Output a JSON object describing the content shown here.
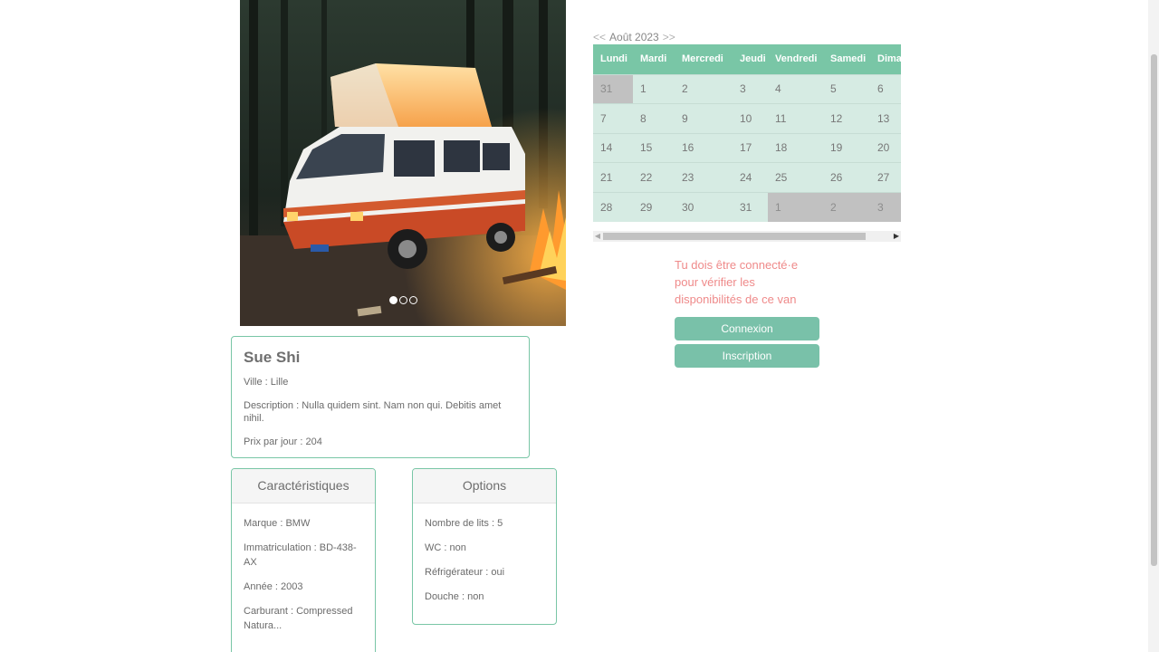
{
  "carousel": {
    "slides": 3,
    "active_slide": 1
  },
  "calendar": {
    "prev": "<<",
    "month_label": "Août 2023",
    "next": ">>",
    "weekdays": [
      "Lundi",
      "Mardi",
      "Mercredi",
      "Jeudi",
      "Vendredi",
      "Samedi",
      "Dimanche"
    ],
    "weeks": [
      [
        "31",
        "1",
        "2",
        "3",
        "4",
        "5",
        "6"
      ],
      [
        "7",
        "8",
        "9",
        "10",
        "11",
        "12",
        "13"
      ],
      [
        "14",
        "15",
        "16",
        "17",
        "18",
        "19",
        "20"
      ],
      [
        "21",
        "22",
        "23",
        "24",
        "25",
        "26",
        "27"
      ],
      [
        "28",
        "29",
        "30",
        "31",
        "1",
        "2",
        "3"
      ]
    ],
    "out_of_month": [
      "0.0",
      "4.4",
      "4.5",
      "4.6"
    ]
  },
  "auth": {
    "message": "Tu dois être connecté·e pour vérifier les disponibilités de ce van",
    "login_label": "Connexion",
    "signup_label": "Inscription"
  },
  "owner": {
    "name": "Sue Shi",
    "city": "Ville : Lille",
    "description": "Description : Nulla quidem sint. Nam non qui. Debitis amet nihil.",
    "price": "Prix par jour : 204"
  },
  "characteristics": {
    "title": "Caractéristiques",
    "items": [
      "Marque : BMW",
      "Immatriculation : BD-438-AX",
      "Année : 2003",
      "Carburant : Compressed Natura..."
    ]
  },
  "options": {
    "title": "Options",
    "items": [
      "Nombre de lits : 5",
      "WC : non",
      "Réfrigérateur : oui",
      "Douche : non"
    ]
  },
  "colors": {
    "accent": "#79c6a6",
    "calendar_cell": "#d6ebe3",
    "out_of_month": "#c1c1c1",
    "warning_text": "#ef8a8a"
  }
}
